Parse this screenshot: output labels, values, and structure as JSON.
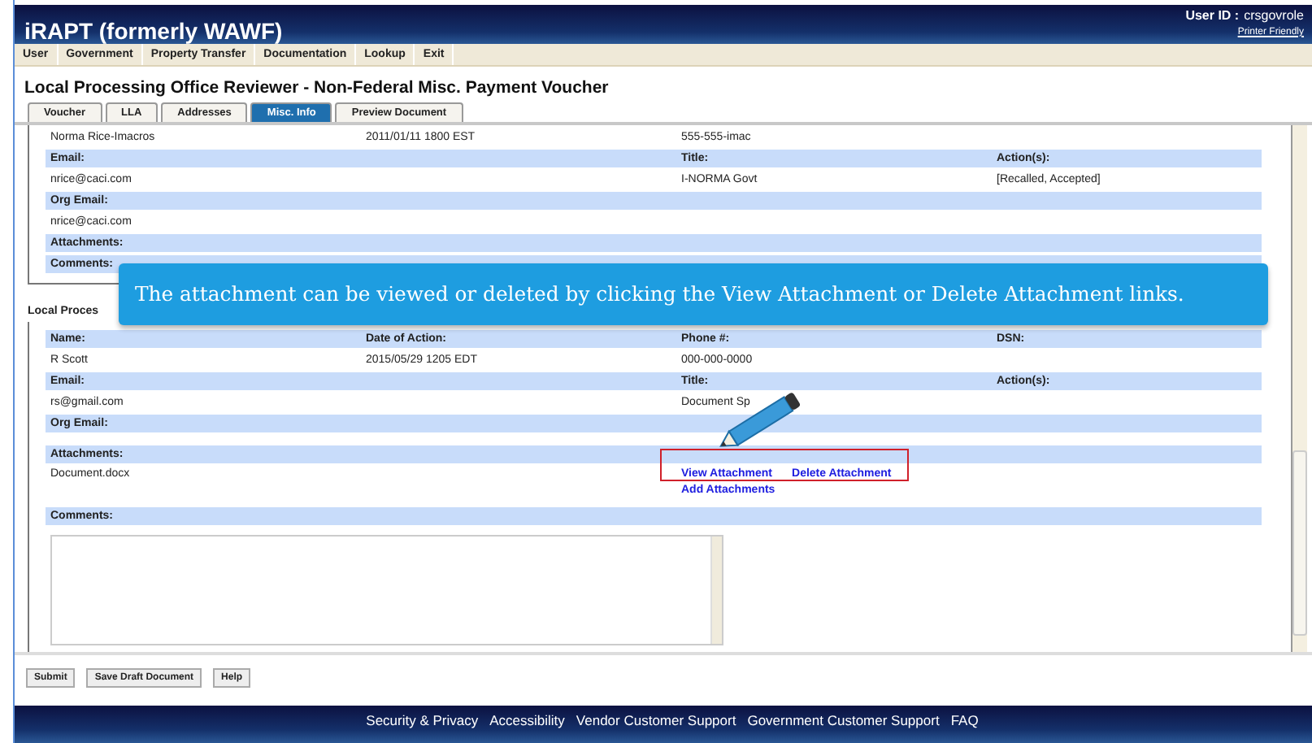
{
  "header": {
    "title": "iRAPT (formerly WAWF)",
    "user_id_label": "User ID :",
    "user_id": "crsgovrole",
    "printer_friendly": "Printer Friendly"
  },
  "menu": [
    "User",
    "Government",
    "Property Transfer",
    "Documentation",
    "Lookup",
    "Exit"
  ],
  "page_title": "Local Processing Office Reviewer - Non-Federal Misc. Payment Voucher",
  "tabs": [
    {
      "label": "Voucher",
      "selected": false
    },
    {
      "label": "LLA",
      "selected": false
    },
    {
      "label": "Addresses",
      "selected": false
    },
    {
      "label": "Misc. Info",
      "selected": true
    },
    {
      "label": "Preview Document",
      "selected": false
    }
  ],
  "sections": [
    {
      "rows": [
        {
          "kind": "value",
          "cells": [
            "Norma Rice-Imacros",
            "2011/01/11 1800 EST",
            "555-555-imac",
            ""
          ]
        },
        {
          "kind": "header",
          "cells": [
            "Email:",
            "",
            "Title:",
            "Action(s):"
          ]
        },
        {
          "kind": "value",
          "cells": [
            "nrice@caci.com",
            "",
            "I-NORMA Govt",
            "[Recalled, Accepted]"
          ]
        },
        {
          "kind": "header",
          "cells": [
            "Org Email:"
          ]
        },
        {
          "kind": "value",
          "cells": [
            "nrice@caci.com"
          ]
        },
        {
          "kind": "header",
          "cells": [
            "Attachments:"
          ]
        },
        {
          "kind": "header",
          "cells": [
            "Comments:"
          ]
        }
      ]
    },
    {
      "legend": "Local Proces",
      "rows": [
        {
          "kind": "header",
          "cells": [
            "Name:",
            "Date of Action:",
            "Phone #:",
            "DSN:"
          ]
        },
        {
          "kind": "value",
          "cells": [
            "R Scott",
            "2015/05/29 1205 EDT",
            "000-000-0000",
            ""
          ]
        },
        {
          "kind": "header",
          "cells": [
            "Email:",
            "",
            "Title:",
            "Action(s):"
          ]
        },
        {
          "kind": "value",
          "cells": [
            "rs@gmail.com",
            "",
            "Document Sp",
            ""
          ]
        },
        {
          "kind": "header",
          "cells": [
            "Org Email:"
          ]
        },
        {
          "kind": "spacer",
          "cells": []
        },
        {
          "kind": "header",
          "cells": [
            "Attachments:"
          ]
        },
        {
          "kind": "attachment",
          "file": "Document.docx",
          "links": [
            "View Attachment",
            "Delete Attachment"
          ],
          "add_link": "Add Attachments"
        },
        {
          "kind": "header",
          "cells": [
            "Comments:"
          ]
        },
        {
          "kind": "textarea"
        }
      ]
    }
  ],
  "callout": {
    "text": "The attachment can be viewed or deleted by clicking the View Attachment or Delete Attachment links."
  },
  "buttons": [
    "Submit",
    "Save Draft Document",
    "Help"
  ],
  "footer": [
    "Security & Privacy",
    "Accessibility",
    "Vendor Customer Support",
    "Government Customer Support",
    "FAQ"
  ]
}
